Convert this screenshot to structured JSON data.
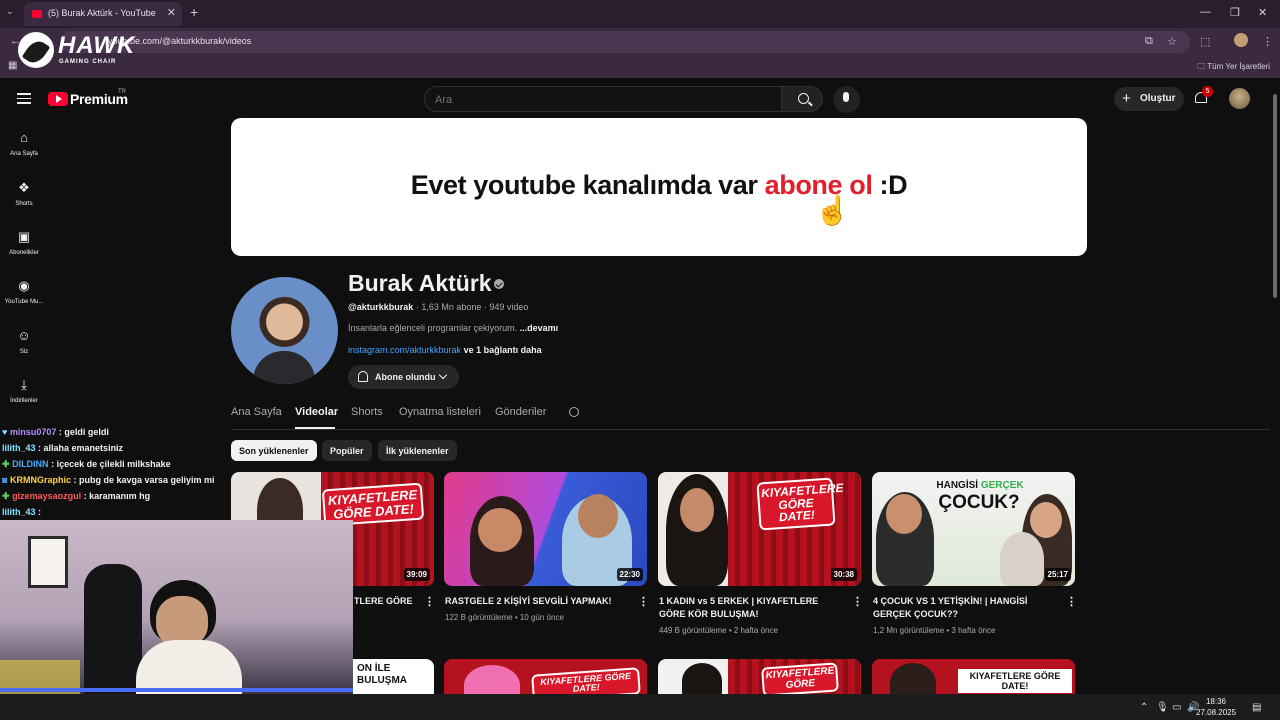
{
  "browser": {
    "tab_title": "(5) Burak Aktürk - YouTube",
    "url": "youtube.com/@akturkkburak/videos",
    "bookmarks_all": "Tüm Yer İşaretleri"
  },
  "overlay_logo": {
    "brand": "HAWK",
    "subtitle": "GAMING CHAIR"
  },
  "header": {
    "logo_text": "Premium",
    "country": "TR",
    "search_placeholder": "Ara",
    "create_label": "Oluştur",
    "notification_count": "5"
  },
  "sidebar": {
    "items": [
      {
        "label": "Ana Sayfa",
        "icon": "home-icon"
      },
      {
        "label": "Shorts",
        "icon": "shorts-icon"
      },
      {
        "label": "Abonelikler",
        "icon": "subscriptions-icon"
      },
      {
        "label": "YouTube Mu...",
        "icon": "youtube-music-icon"
      },
      {
        "label": "Siz",
        "icon": "you-icon"
      },
      {
        "label": "İndirilenler",
        "icon": "download-icon"
      }
    ]
  },
  "banner": {
    "text_before": "Evet youtube kanalımda var ",
    "text_accent": "abone ol",
    "text_after": " :D"
  },
  "channel": {
    "name": "Burak Aktürk",
    "handle": "@akturkkburak",
    "subscribers": "1,63 Mn abone",
    "video_count": "949 video",
    "description": "İnsanlarla eğlenceli programlar çekiyorum.",
    "more": "...devamı",
    "link": "instagram.com/akturkkburak",
    "link_more": "ve 1 bağlantı daha",
    "subscribe_label": "Abone olundu"
  },
  "tabs": [
    "Ana Sayfa",
    "Videolar",
    "Shorts",
    "Oynatma listeleri",
    "Gönderiler"
  ],
  "chips": [
    "Son yüklenenler",
    "Popüler",
    "İlk yüklenenler"
  ],
  "videos": [
    {
      "title": "TLERE GÖRE",
      "duration": "39:09",
      "views": "",
      "age": "",
      "badge": "KIYAFETLERE GÖRE DATE!"
    },
    {
      "title": "RASTGELE 2 KİŞİYİ SEVGİLİ YAPMAK!",
      "duration": "22:30",
      "views": "122 B görüntüleme",
      "age": "10 gün önce"
    },
    {
      "title": "1 KADIN vs 5 ERKEK | KIYAFETLERE GÖRE KÖR BULUŞMA!",
      "duration": "30:38",
      "views": "449 B görüntüleme",
      "age": "2 hafta önce",
      "badge": "KIYAFETLERE GÖRE DATE!"
    },
    {
      "title": "4 ÇOCUK VS 1 YETİŞKİN! | HANGİSİ GERÇEK ÇOCUK??",
      "duration": "25:17",
      "views": "1,2 Mn görüntüleme",
      "age": "3 hafta önce",
      "badge_top": "HANGİSİ",
      "badge_accent": "GERÇEK",
      "badge_bottom": "ÇOCUK?"
    }
  ],
  "row2_badges": [
    "ON İLE BULUŞMA",
    "KIYAFETLERE GÖRE DATE!",
    "KIYAFETLERE GÖRE",
    "KIYAFETLERE GÖRE DATE!"
  ],
  "chat": [
    {
      "user": "minsu0707",
      "msg": ": geldi geldi",
      "color": "#b48cff"
    },
    {
      "user": "lilith_43",
      "msg": ": allaha emanetsiniz",
      "color": "#7fe3ff"
    },
    {
      "user": "DILDINN",
      "msg": ": içecek de çilekli milkshake",
      "color": "#4aa8ff"
    },
    {
      "user": "KRMNGraphic",
      "msg": ": pubg de kavga varsa geliyim mi",
      "color": "#ffd24a"
    },
    {
      "user": "gizemaysaozgul",
      "msg": ": karamanım hg",
      "color": "#ff5a5a"
    },
    {
      "user": "lilith_43",
      "msg": ":",
      "color": "#7fe3ff"
    }
  ],
  "taskbar": {
    "time": "18:36",
    "date": "27.08.2025"
  },
  "colors": {
    "background": "#0f0f0f",
    "youtube_red": "#ff0033",
    "link_blue": "#3ea6ff",
    "banner_accent": "#e0202c"
  }
}
